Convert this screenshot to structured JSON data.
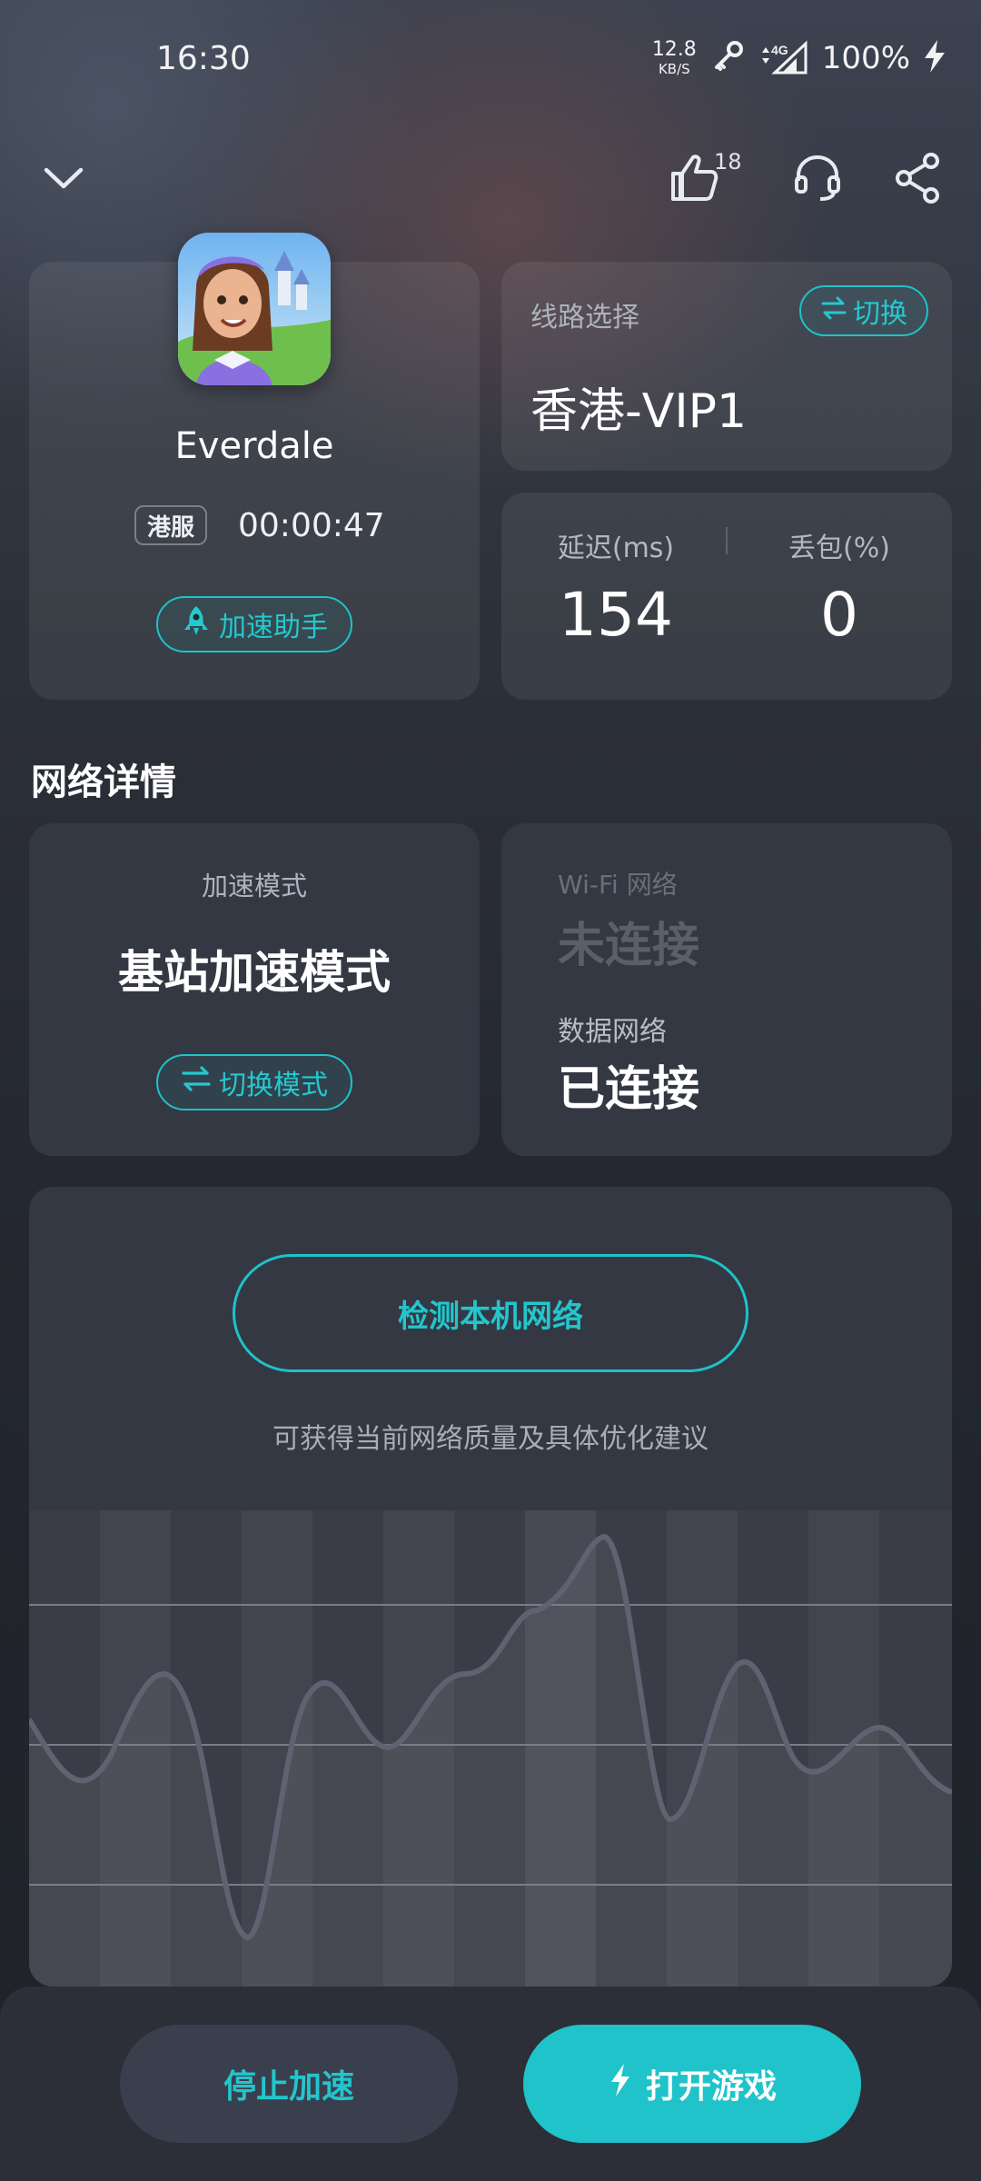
{
  "status_bar": {
    "time": "16:30",
    "net_speed_value": "12.8",
    "net_speed_unit": "KB/S",
    "network_type": "4G",
    "battery": "100%"
  },
  "top_bar": {
    "like_count": "18"
  },
  "game": {
    "name": "Everdale",
    "region_badge": "港服",
    "elapsed": "00:00:47",
    "assistant_label": "加速助手"
  },
  "route": {
    "label": "线路选择",
    "switch_label": "切换",
    "name": "香港-VIP1"
  },
  "metrics": {
    "latency_label": "延迟(ms)",
    "latency_value": "154",
    "loss_label": "丢包(%)",
    "loss_value": "0"
  },
  "network_section": {
    "title": "网络详情",
    "mode_label": "加速模式",
    "mode_value": "基站加速模式",
    "mode_switch_label": "切换模式",
    "wifi_label": "Wi-Fi 网络",
    "wifi_state": "未连接",
    "data_label": "数据网络",
    "data_state": "已连接"
  },
  "diagnose": {
    "button_label": "检测本机网络",
    "hint": "可获得当前网络质量及具体优化建议"
  },
  "bottom": {
    "stop_label": "停止加速",
    "open_label": "打开游戏"
  },
  "colors": {
    "accent": "#1fc3c9",
    "background": "#23262e",
    "card": "#343843"
  },
  "icons": [
    "chevron-down-icon",
    "thumbs-up-icon",
    "headset-icon",
    "share-icon",
    "rocket-icon",
    "swap-icon",
    "lightning-icon",
    "key-icon",
    "signal-icon",
    "battery-charging-icon"
  ]
}
